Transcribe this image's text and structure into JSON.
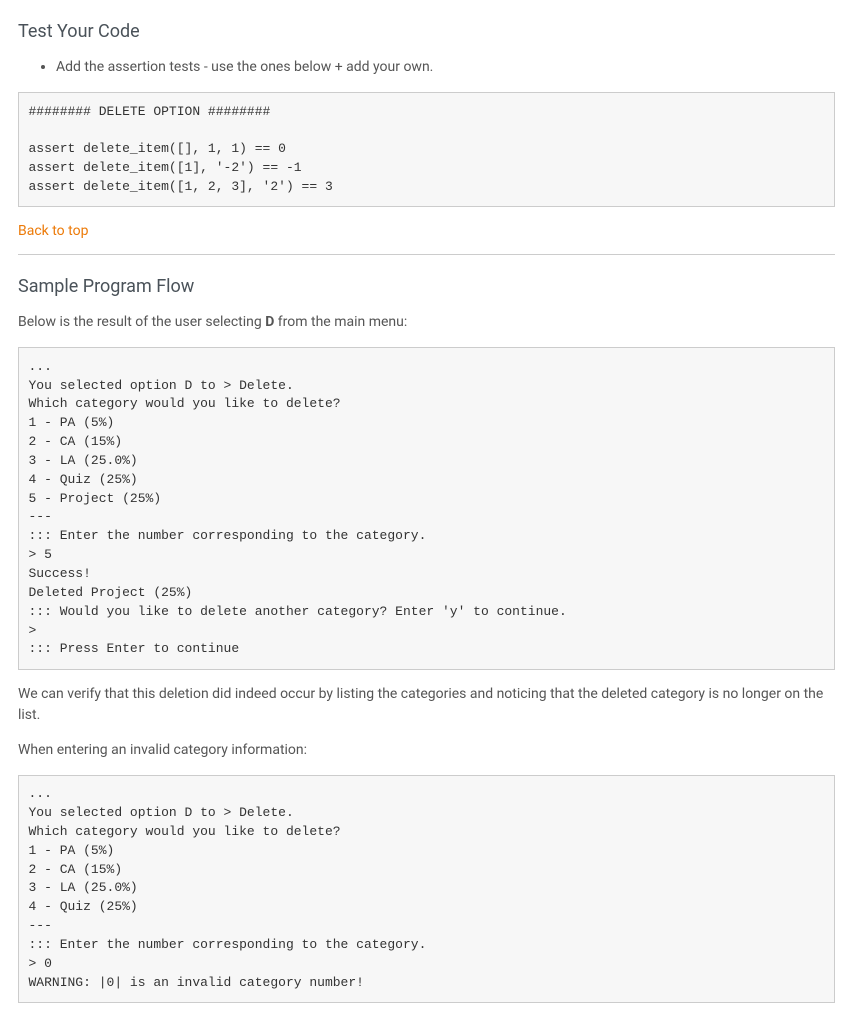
{
  "section1": {
    "heading": "Test Your Code",
    "bullet": "Add the assertion tests - use the ones below + add your own.",
    "code": "######## DELETE OPTION ########\n\nassert delete_item([], 1, 1) == 0\nassert delete_item([1], '-2') == -1\nassert delete_item([1, 2, 3], '2') == 3"
  },
  "back_to_top": "Back to top",
  "section2": {
    "heading": "Sample Program Flow",
    "intro_pre": "Below is the result of the user selecting ",
    "intro_bold": "D",
    "intro_post": " from the main menu:",
    "code1": "...\nYou selected option D to > Delete.\nWhich category would you like to delete?\n1 - PA (5%)\n2 - CA (15%)\n3 - LA (25.0%)\n4 - Quiz (25%)\n5 - Project (25%)\n---\n::: Enter the number corresponding to the category.\n> 5\nSuccess!\nDeleted Project (25%)\n::: Would you like to delete another category? Enter 'y' to continue.\n> \n::: Press Enter to continue",
    "verify_text": "We can verify that this deletion did indeed occur by listing the categories and noticing that the deleted category is no longer on the list.",
    "invalid_text": "When entering an invalid category information:",
    "code2": "...\nYou selected option D to > Delete.\nWhich category would you like to delete?\n1 - PA (5%)\n2 - CA (15%)\n3 - LA (25.0%)\n4 - Quiz (25%)\n---\n::: Enter the number corresponding to the category.\n> 0\nWARNING: |0| is an invalid category number!"
  }
}
